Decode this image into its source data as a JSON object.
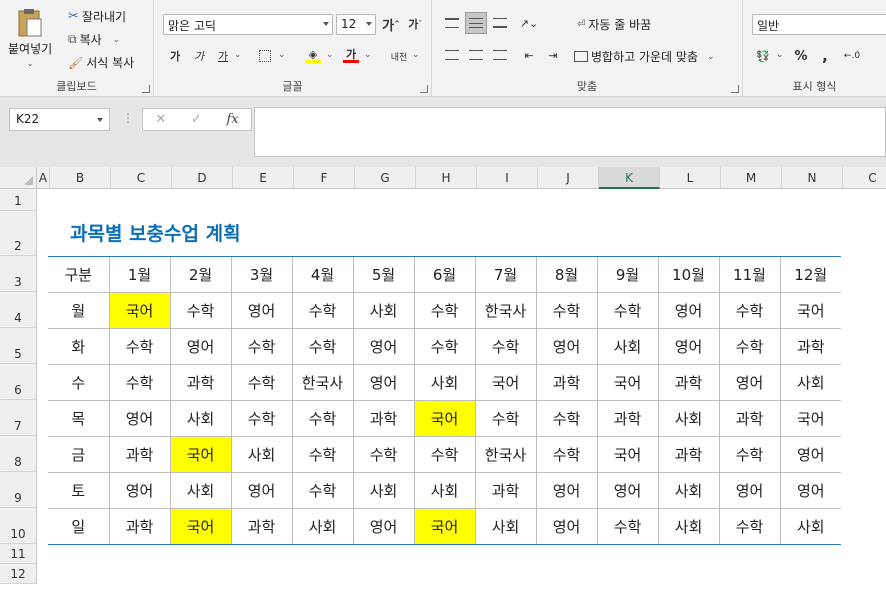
{
  "ribbon": {
    "clipboard": {
      "paste": "붙여넣기",
      "cut": "잘라내기",
      "copy": "복사",
      "format_painter": "서식 복사",
      "group_label": "클립보드"
    },
    "font": {
      "font_name": "맑은 고딕",
      "font_size": "12",
      "bold": "가",
      "italic": "가",
      "underline": "가",
      "font_color_glyph": "가",
      "phonetic": "내천",
      "group_label": "글꼴",
      "colors": {
        "fill": "#ffff00",
        "font": "#ff0000"
      }
    },
    "alignment": {
      "wrap_text": "자동 줄 바꿈",
      "merge_center": "병합하고 가운데 맞춤",
      "group_label": "맞춤"
    },
    "number": {
      "format": "일반",
      "percent": "%",
      "comma": ",",
      "group_label": "표시 형식"
    }
  },
  "formula_bar": {
    "name_box": "K22",
    "cancel": "✕",
    "enter": "✓",
    "fx": "fx",
    "formula": ""
  },
  "grid": {
    "columns": [
      "A",
      "B",
      "C",
      "D",
      "E",
      "F",
      "G",
      "H",
      "I",
      "J",
      "K",
      "L",
      "M",
      "N",
      "C"
    ],
    "selected_column": "K",
    "rows": [
      "1",
      "2",
      "3",
      "4",
      "5",
      "6",
      "7",
      "8",
      "9",
      "10",
      "11",
      "12"
    ]
  },
  "sheet": {
    "title": "과목별 보충수업 계획",
    "highlight_color": "#ffff00",
    "header": [
      "구분",
      "1월",
      "2월",
      "3월",
      "4월",
      "5월",
      "6월",
      "7월",
      "8월",
      "9월",
      "10월",
      "11월",
      "12월"
    ],
    "rows": [
      [
        "월",
        "국어",
        "수학",
        "영어",
        "수학",
        "사회",
        "수학",
        "한국사",
        "수학",
        "수학",
        "영어",
        "수학",
        "국어"
      ],
      [
        "화",
        "수학",
        "영어",
        "수학",
        "수학",
        "영어",
        "수학",
        "수학",
        "영어",
        "사회",
        "영어",
        "수학",
        "과학"
      ],
      [
        "수",
        "수학",
        "과학",
        "수학",
        "한국사",
        "영어",
        "사회",
        "국어",
        "과학",
        "국어",
        "과학",
        "영어",
        "사회"
      ],
      [
        "목",
        "영어",
        "사회",
        "수학",
        "수학",
        "과학",
        "국어",
        "수학",
        "수학",
        "과학",
        "사회",
        "과학",
        "국어"
      ],
      [
        "금",
        "과학",
        "국어",
        "사회",
        "수학",
        "수학",
        "수학",
        "한국사",
        "수학",
        "국어",
        "과학",
        "수학",
        "영어"
      ],
      [
        "토",
        "영어",
        "사회",
        "영어",
        "수학",
        "사회",
        "사회",
        "과학",
        "영어",
        "영어",
        "사회",
        "영어",
        "영어"
      ],
      [
        "일",
        "과학",
        "국어",
        "과학",
        "사회",
        "영어",
        "국어",
        "사회",
        "영어",
        "수학",
        "사회",
        "수학",
        "사회"
      ]
    ],
    "highlighted": [
      [
        0,
        1
      ],
      [
        3,
        6
      ],
      [
        4,
        2
      ],
      [
        6,
        2
      ],
      [
        6,
        6
      ]
    ]
  }
}
